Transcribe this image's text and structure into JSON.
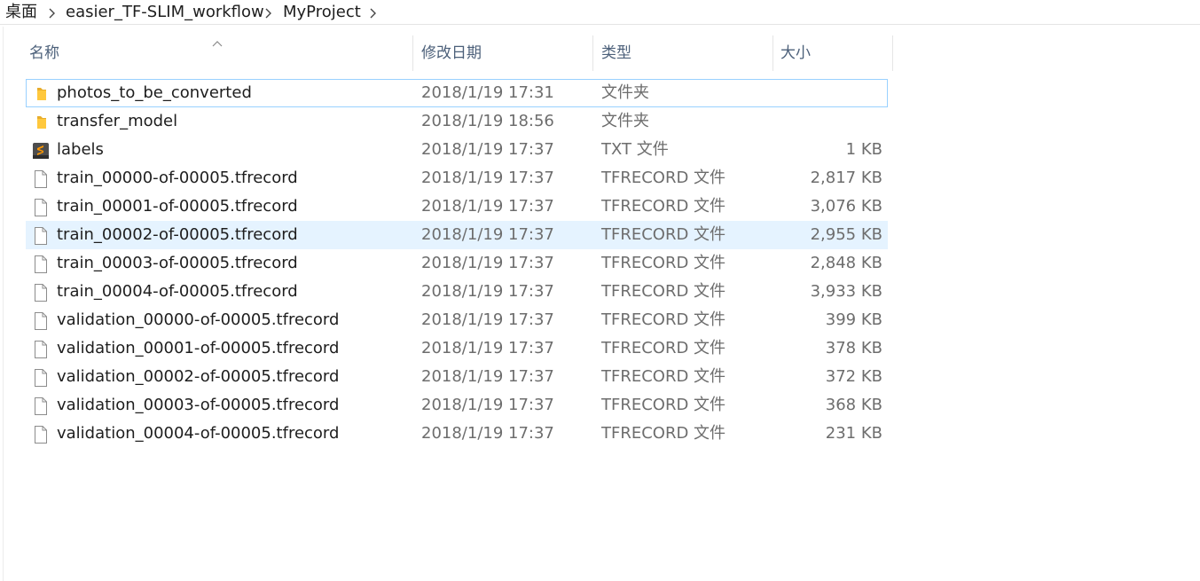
{
  "breadcrumb": {
    "items": [
      "桌面",
      "easier_TF-SLIM_workflow",
      "MyProject"
    ]
  },
  "columns": {
    "name": "名称",
    "date": "修改日期",
    "type": "类型",
    "size": "大小"
  },
  "sort": {
    "column": "name",
    "direction": "ascending"
  },
  "colors": {
    "folder_icon": "#ffc83d",
    "sublime_icon_bg": "#4d4d4d",
    "sublime_icon_fg": "#ff9800",
    "focused_row_border": "#99d1ff",
    "hovered_row_bg": "#e5f3ff",
    "header_text": "#4c607a"
  },
  "files": [
    {
      "name": "photos_to_be_converted",
      "date": "2018/1/19 17:31",
      "type": "文件夹",
      "size": "",
      "icon": "folder-icon",
      "state": "focused"
    },
    {
      "name": "transfer_model",
      "date": "2018/1/19 18:56",
      "type": "文件夹",
      "size": "",
      "icon": "folder-icon",
      "state": ""
    },
    {
      "name": "labels",
      "date": "2018/1/19 17:37",
      "type": "TXT 文件",
      "size": "1 KB",
      "icon": "sublime-text-file-icon",
      "state": ""
    },
    {
      "name": "train_00000-of-00005.tfrecord",
      "date": "2018/1/19 17:37",
      "type": "TFRECORD 文件",
      "size": "2,817 KB",
      "icon": "blank-file-icon",
      "state": ""
    },
    {
      "name": "train_00001-of-00005.tfrecord",
      "date": "2018/1/19 17:37",
      "type": "TFRECORD 文件",
      "size": "3,076 KB",
      "icon": "blank-file-icon",
      "state": ""
    },
    {
      "name": "train_00002-of-00005.tfrecord",
      "date": "2018/1/19 17:37",
      "type": "TFRECORD 文件",
      "size": "2,955 KB",
      "icon": "blank-file-icon",
      "state": "hovered"
    },
    {
      "name": "train_00003-of-00005.tfrecord",
      "date": "2018/1/19 17:37",
      "type": "TFRECORD 文件",
      "size": "2,848 KB",
      "icon": "blank-file-icon",
      "state": ""
    },
    {
      "name": "train_00004-of-00005.tfrecord",
      "date": "2018/1/19 17:37",
      "type": "TFRECORD 文件",
      "size": "3,933 KB",
      "icon": "blank-file-icon",
      "state": ""
    },
    {
      "name": "validation_00000-of-00005.tfrecord",
      "date": "2018/1/19 17:37",
      "type": "TFRECORD 文件",
      "size": "399 KB",
      "icon": "blank-file-icon",
      "state": ""
    },
    {
      "name": "validation_00001-of-00005.tfrecord",
      "date": "2018/1/19 17:37",
      "type": "TFRECORD 文件",
      "size": "378 KB",
      "icon": "blank-file-icon",
      "state": ""
    },
    {
      "name": "validation_00002-of-00005.tfrecord",
      "date": "2018/1/19 17:37",
      "type": "TFRECORD 文件",
      "size": "372 KB",
      "icon": "blank-file-icon",
      "state": ""
    },
    {
      "name": "validation_00003-of-00005.tfrecord",
      "date": "2018/1/19 17:37",
      "type": "TFRECORD 文件",
      "size": "368 KB",
      "icon": "blank-file-icon",
      "state": ""
    },
    {
      "name": "validation_00004-of-00005.tfrecord",
      "date": "2018/1/19 17:37",
      "type": "TFRECORD 文件",
      "size": "231 KB",
      "icon": "blank-file-icon",
      "state": ""
    }
  ]
}
